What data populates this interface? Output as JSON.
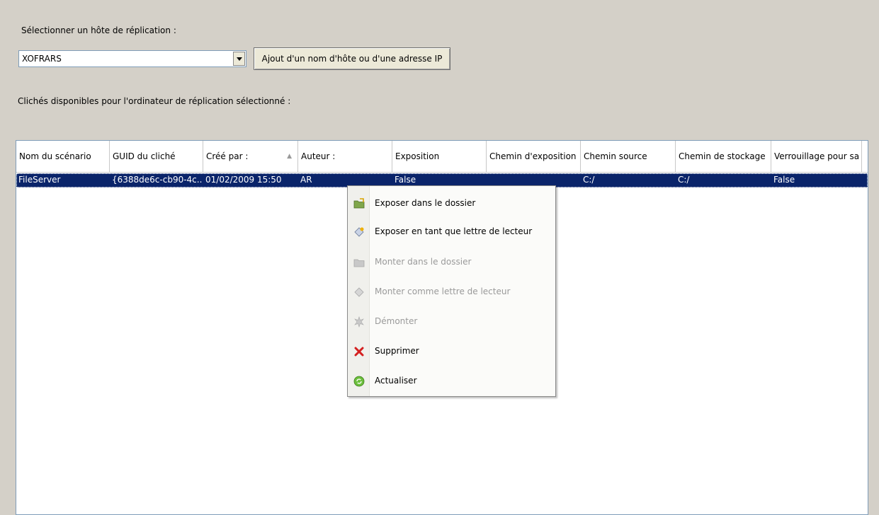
{
  "host_label": "Sélectionner un hôte de réplication :",
  "host_select": {
    "value": "XOFRARS"
  },
  "add_host_button": "Ajout d'un nom d'hôte ou d'une adresse IP",
  "snapshots_label": "Clichés disponibles pour l'ordinateur de réplication sélectionné :",
  "table": {
    "columns": [
      "Nom du scénario",
      "GUID du cliché",
      "Créé par :",
      "Auteur :",
      "Exposition",
      "Chemin d'exposition",
      "Chemin source",
      "Chemin de stockage",
      "Verrouillage pour sa"
    ],
    "sorted_column_indicator": "▲",
    "rows": [
      [
        "FileServer",
        "{6388de6c-cb90-4c...",
        "01/02/2009 15:50",
        "AR",
        "False",
        "",
        "C:/",
        "C:/",
        "False"
      ]
    ]
  },
  "context_menu": {
    "items": [
      {
        "label": "Exposer dans le dossier",
        "icon": "folder-expose-icon",
        "enabled": true
      },
      {
        "label": "Exposer en tant que lettre de lecteur",
        "icon": "drive-expose-icon",
        "enabled": true
      },
      {
        "label": "Monter dans le dossier",
        "icon": "folder-mount-icon",
        "enabled": false
      },
      {
        "label": "Monter comme lettre de lecteur",
        "icon": "drive-mount-icon",
        "enabled": false
      },
      {
        "label": "Démonter",
        "icon": "unmount-icon",
        "enabled": false
      },
      {
        "label": "Supprimer",
        "icon": "delete-icon",
        "enabled": true
      },
      {
        "label": "Actualiser",
        "icon": "refresh-icon",
        "enabled": true
      }
    ]
  }
}
